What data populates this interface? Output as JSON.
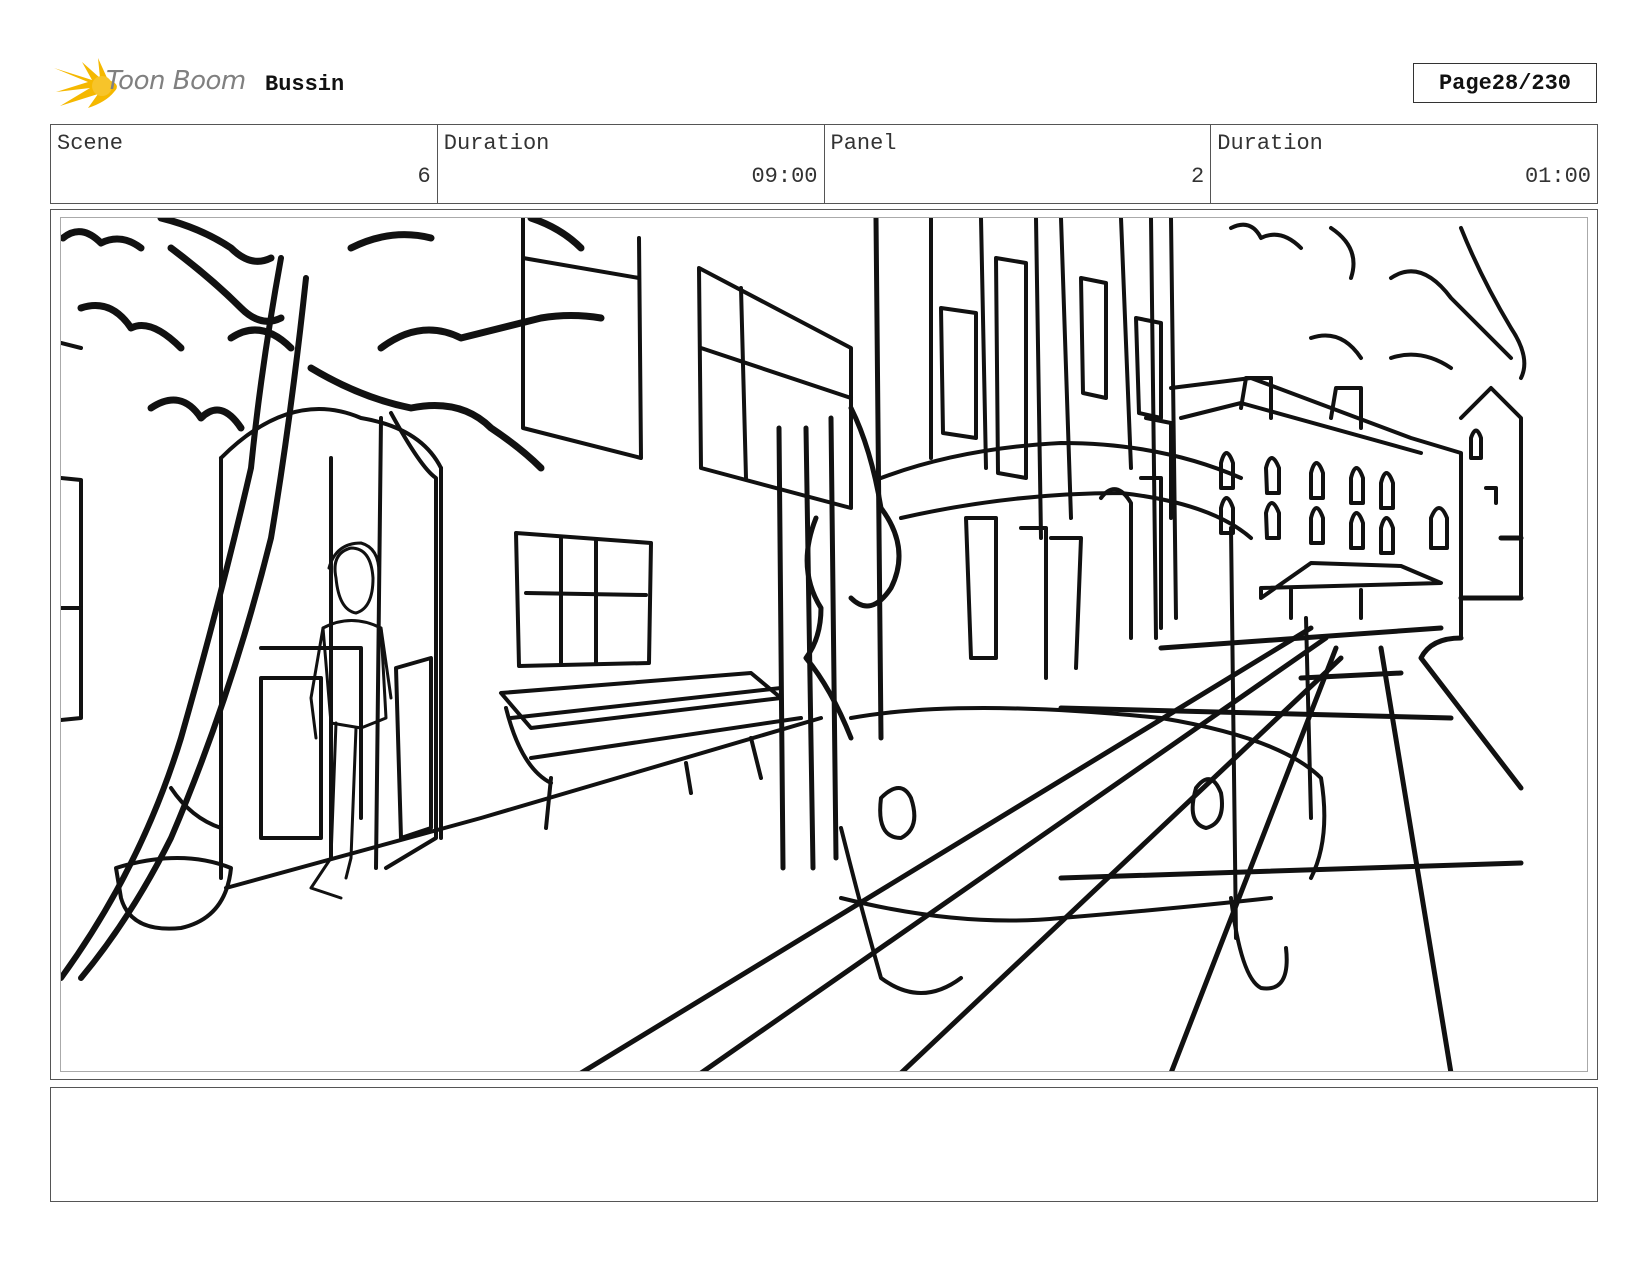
{
  "header": {
    "logo_text": "Toon Boom",
    "project_title": "Bussin",
    "page_label": "Page",
    "page_value": "28/230"
  },
  "info": {
    "scene_label": "Scene",
    "scene_value": "6",
    "scene_duration_label": "Duration",
    "scene_duration_value": "09:00",
    "panel_label": "Panel",
    "panel_value": "2",
    "panel_duration_label": "Duration",
    "panel_duration_value": "01:00"
  },
  "colors": {
    "logo_yellow": "#F5B800",
    "logo_gray": "#808080"
  }
}
